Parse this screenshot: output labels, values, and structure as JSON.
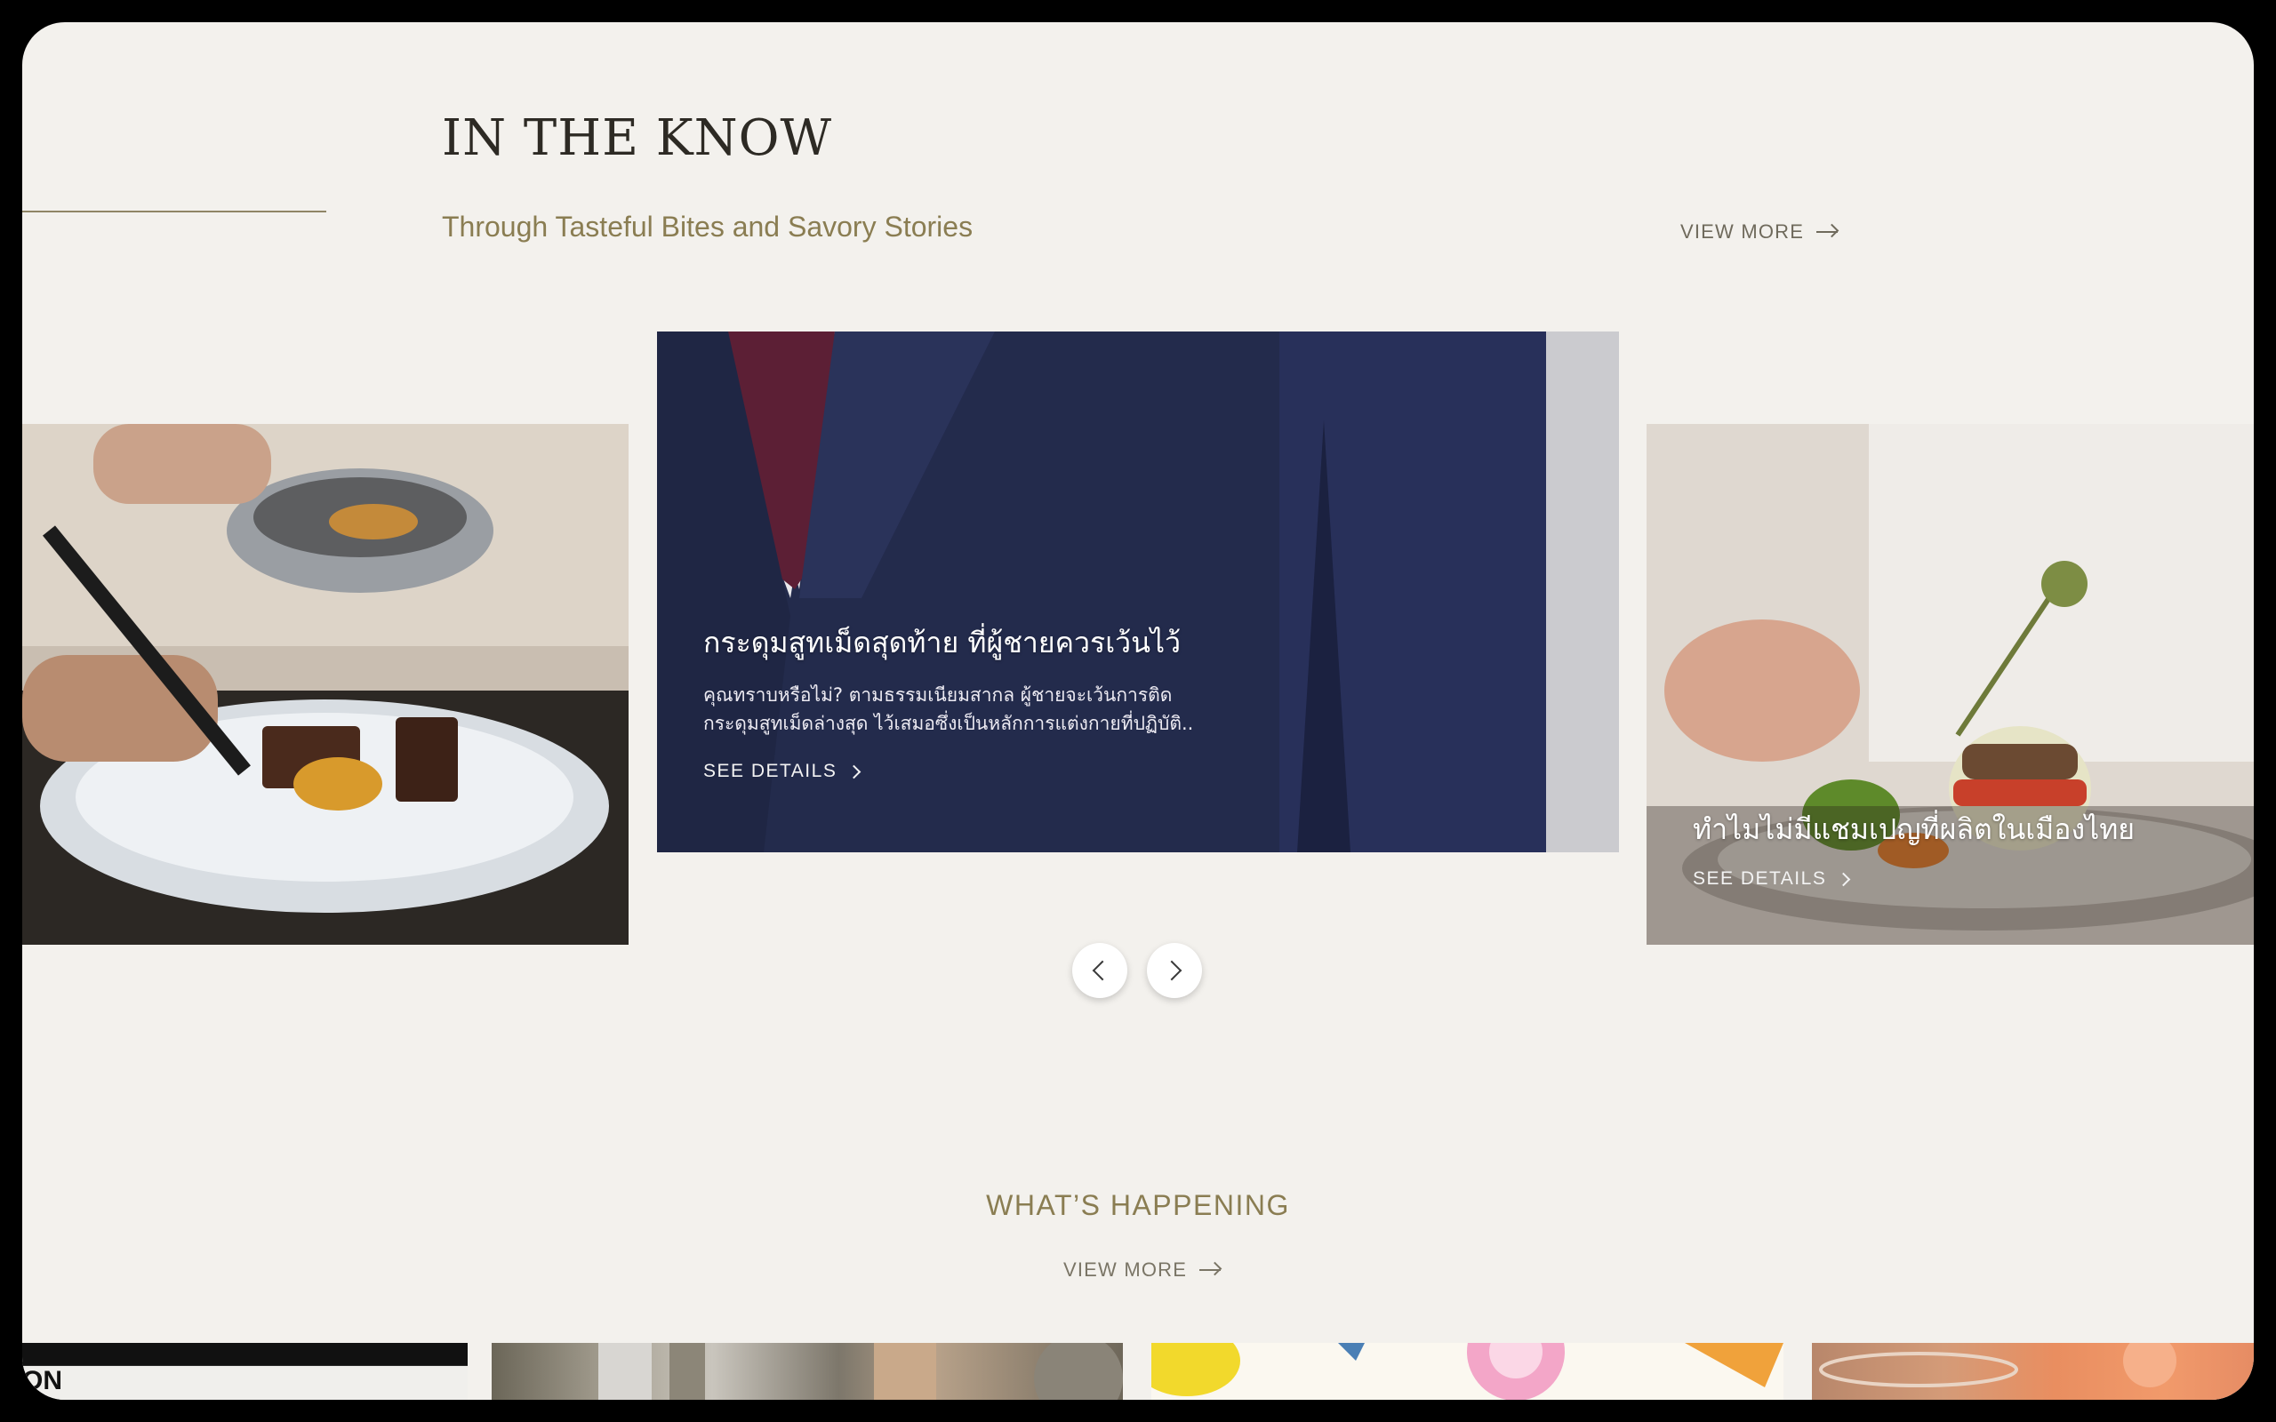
{
  "in_the_know": {
    "title": "IN THE KNOW",
    "subtitle": "Through Tasteful Bites and Savory Stories",
    "view_more_label": "VIEW MORE"
  },
  "carousel": {
    "cards": [
      {
        "position": "left",
        "image": "chef-plating-dessert"
      },
      {
        "position": "center",
        "image": "navy-suit-jacket",
        "title": "กระดุมสูทเม็ดสุดท้าย ที่ผู้ชายควรเว้นไว้",
        "description": "คุณทราบหรือไม่? ตามธรรมเนียมสากล ผู้ชายจะเว้นการติด กระดุมสูทเม็ดล่างสุด ไว้เสมอซึ่งเป็นหลักการแต่งกายที่ปฏิบัติ..",
        "cta": "SEE DETAILS"
      },
      {
        "position": "right",
        "image": "chef-garnishing-dish",
        "title": "ทำไมไม่มีแชมเปญที่ผลิตในเมืองไทย",
        "cta": "SEE DETAILS"
      }
    ],
    "prev_icon": "chevron-left-icon",
    "next_icon": "chevron-right-icon"
  },
  "whats_happening": {
    "title": "WHAT’S HAPPENING",
    "view_more_label": "VIEW MORE",
    "thumbnails": [
      {
        "image": "event-thumbnail-1",
        "visible_text": "ON"
      },
      {
        "image": "event-thumbnail-2"
      },
      {
        "image": "event-thumbnail-3"
      },
      {
        "image": "event-thumbnail-4"
      }
    ]
  },
  "colors": {
    "background": "#f3f1ed",
    "accent_gold": "#8a7d52",
    "heading_dark": "#2d2a24",
    "frame": "#000000"
  }
}
